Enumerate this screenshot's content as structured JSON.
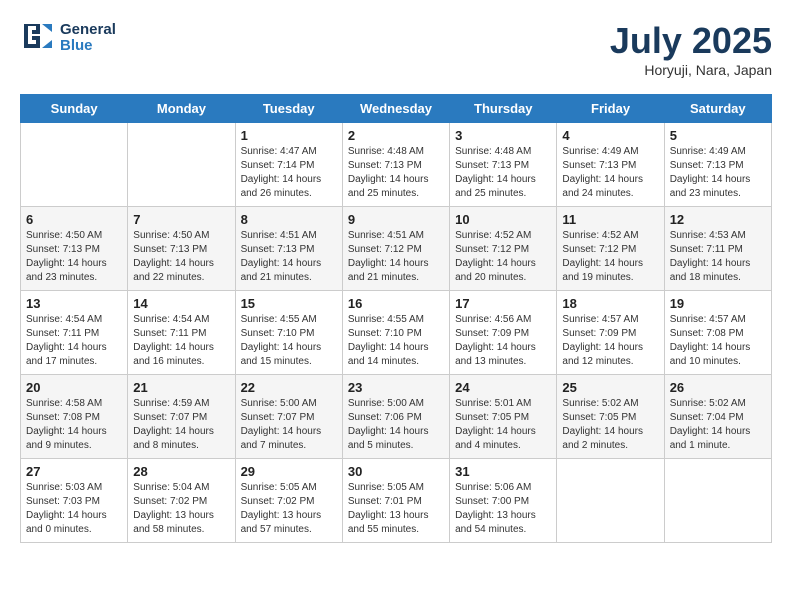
{
  "logo": {
    "line1": "General",
    "line2": "Blue"
  },
  "title": "July 2025",
  "subtitle": "Horyuji, Nara, Japan",
  "days_of_week": [
    "Sunday",
    "Monday",
    "Tuesday",
    "Wednesday",
    "Thursday",
    "Friday",
    "Saturday"
  ],
  "weeks": [
    [
      {
        "day": "",
        "sunrise": "",
        "sunset": "",
        "daylight": ""
      },
      {
        "day": "",
        "sunrise": "",
        "sunset": "",
        "daylight": ""
      },
      {
        "day": "1",
        "sunrise": "Sunrise: 4:47 AM",
        "sunset": "Sunset: 7:14 PM",
        "daylight": "Daylight: 14 hours and 26 minutes."
      },
      {
        "day": "2",
        "sunrise": "Sunrise: 4:48 AM",
        "sunset": "Sunset: 7:13 PM",
        "daylight": "Daylight: 14 hours and 25 minutes."
      },
      {
        "day": "3",
        "sunrise": "Sunrise: 4:48 AM",
        "sunset": "Sunset: 7:13 PM",
        "daylight": "Daylight: 14 hours and 25 minutes."
      },
      {
        "day": "4",
        "sunrise": "Sunrise: 4:49 AM",
        "sunset": "Sunset: 7:13 PM",
        "daylight": "Daylight: 14 hours and 24 minutes."
      },
      {
        "day": "5",
        "sunrise": "Sunrise: 4:49 AM",
        "sunset": "Sunset: 7:13 PM",
        "daylight": "Daylight: 14 hours and 23 minutes."
      }
    ],
    [
      {
        "day": "6",
        "sunrise": "Sunrise: 4:50 AM",
        "sunset": "Sunset: 7:13 PM",
        "daylight": "Daylight: 14 hours and 23 minutes."
      },
      {
        "day": "7",
        "sunrise": "Sunrise: 4:50 AM",
        "sunset": "Sunset: 7:13 PM",
        "daylight": "Daylight: 14 hours and 22 minutes."
      },
      {
        "day": "8",
        "sunrise": "Sunrise: 4:51 AM",
        "sunset": "Sunset: 7:13 PM",
        "daylight": "Daylight: 14 hours and 21 minutes."
      },
      {
        "day": "9",
        "sunrise": "Sunrise: 4:51 AM",
        "sunset": "Sunset: 7:12 PM",
        "daylight": "Daylight: 14 hours and 21 minutes."
      },
      {
        "day": "10",
        "sunrise": "Sunrise: 4:52 AM",
        "sunset": "Sunset: 7:12 PM",
        "daylight": "Daylight: 14 hours and 20 minutes."
      },
      {
        "day": "11",
        "sunrise": "Sunrise: 4:52 AM",
        "sunset": "Sunset: 7:12 PM",
        "daylight": "Daylight: 14 hours and 19 minutes."
      },
      {
        "day": "12",
        "sunrise": "Sunrise: 4:53 AM",
        "sunset": "Sunset: 7:11 PM",
        "daylight": "Daylight: 14 hours and 18 minutes."
      }
    ],
    [
      {
        "day": "13",
        "sunrise": "Sunrise: 4:54 AM",
        "sunset": "Sunset: 7:11 PM",
        "daylight": "Daylight: 14 hours and 17 minutes."
      },
      {
        "day": "14",
        "sunrise": "Sunrise: 4:54 AM",
        "sunset": "Sunset: 7:11 PM",
        "daylight": "Daylight: 14 hours and 16 minutes."
      },
      {
        "day": "15",
        "sunrise": "Sunrise: 4:55 AM",
        "sunset": "Sunset: 7:10 PM",
        "daylight": "Daylight: 14 hours and 15 minutes."
      },
      {
        "day": "16",
        "sunrise": "Sunrise: 4:55 AM",
        "sunset": "Sunset: 7:10 PM",
        "daylight": "Daylight: 14 hours and 14 minutes."
      },
      {
        "day": "17",
        "sunrise": "Sunrise: 4:56 AM",
        "sunset": "Sunset: 7:09 PM",
        "daylight": "Daylight: 14 hours and 13 minutes."
      },
      {
        "day": "18",
        "sunrise": "Sunrise: 4:57 AM",
        "sunset": "Sunset: 7:09 PM",
        "daylight": "Daylight: 14 hours and 12 minutes."
      },
      {
        "day": "19",
        "sunrise": "Sunrise: 4:57 AM",
        "sunset": "Sunset: 7:08 PM",
        "daylight": "Daylight: 14 hours and 10 minutes."
      }
    ],
    [
      {
        "day": "20",
        "sunrise": "Sunrise: 4:58 AM",
        "sunset": "Sunset: 7:08 PM",
        "daylight": "Daylight: 14 hours and 9 minutes."
      },
      {
        "day": "21",
        "sunrise": "Sunrise: 4:59 AM",
        "sunset": "Sunset: 7:07 PM",
        "daylight": "Daylight: 14 hours and 8 minutes."
      },
      {
        "day": "22",
        "sunrise": "Sunrise: 5:00 AM",
        "sunset": "Sunset: 7:07 PM",
        "daylight": "Daylight: 14 hours and 7 minutes."
      },
      {
        "day": "23",
        "sunrise": "Sunrise: 5:00 AM",
        "sunset": "Sunset: 7:06 PM",
        "daylight": "Daylight: 14 hours and 5 minutes."
      },
      {
        "day": "24",
        "sunrise": "Sunrise: 5:01 AM",
        "sunset": "Sunset: 7:05 PM",
        "daylight": "Daylight: 14 hours and 4 minutes."
      },
      {
        "day": "25",
        "sunrise": "Sunrise: 5:02 AM",
        "sunset": "Sunset: 7:05 PM",
        "daylight": "Daylight: 14 hours and 2 minutes."
      },
      {
        "day": "26",
        "sunrise": "Sunrise: 5:02 AM",
        "sunset": "Sunset: 7:04 PM",
        "daylight": "Daylight: 14 hours and 1 minute."
      }
    ],
    [
      {
        "day": "27",
        "sunrise": "Sunrise: 5:03 AM",
        "sunset": "Sunset: 7:03 PM",
        "daylight": "Daylight: 14 hours and 0 minutes."
      },
      {
        "day": "28",
        "sunrise": "Sunrise: 5:04 AM",
        "sunset": "Sunset: 7:02 PM",
        "daylight": "Daylight: 13 hours and 58 minutes."
      },
      {
        "day": "29",
        "sunrise": "Sunrise: 5:05 AM",
        "sunset": "Sunset: 7:02 PM",
        "daylight": "Daylight: 13 hours and 57 minutes."
      },
      {
        "day": "30",
        "sunrise": "Sunrise: 5:05 AM",
        "sunset": "Sunset: 7:01 PM",
        "daylight": "Daylight: 13 hours and 55 minutes."
      },
      {
        "day": "31",
        "sunrise": "Sunrise: 5:06 AM",
        "sunset": "Sunset: 7:00 PM",
        "daylight": "Daylight: 13 hours and 54 minutes."
      },
      {
        "day": "",
        "sunrise": "",
        "sunset": "",
        "daylight": ""
      },
      {
        "day": "",
        "sunrise": "",
        "sunset": "",
        "daylight": ""
      }
    ]
  ]
}
